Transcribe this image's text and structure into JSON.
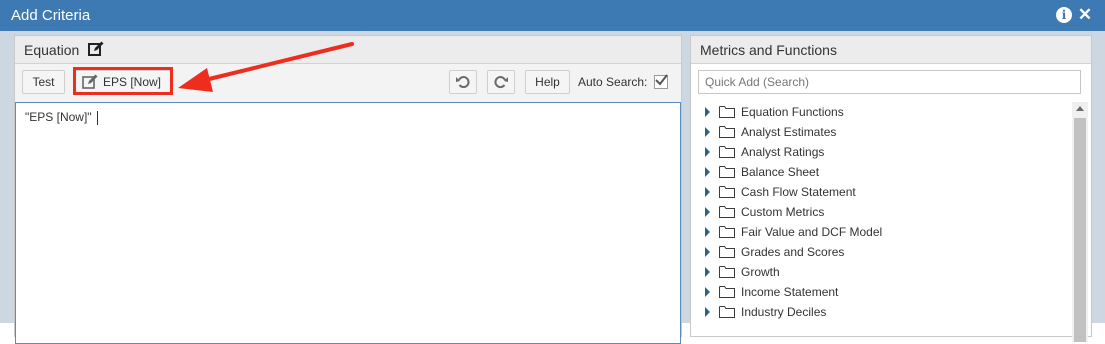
{
  "window": {
    "title": "Add Criteria",
    "info_icon": "info-icon",
    "close_icon": "close-icon"
  },
  "equation": {
    "title": "Equation",
    "title_icon": "edit-icon",
    "toolbar": {
      "test_label": "Test",
      "eps_label": "EPS [Now]",
      "eps_icon": "pencil-edit-icon",
      "undo_icon": "undo-icon",
      "redo_icon": "redo-icon",
      "help_label": "Help",
      "auto_search_label": "Auto Search:",
      "auto_search_checked": true
    },
    "editor_text": "\"EPS [Now]\""
  },
  "metrics": {
    "title": "Metrics and Functions",
    "search_placeholder": "Quick Add (Search)",
    "items": [
      {
        "label": "Equation Functions"
      },
      {
        "label": "Analyst Estimates"
      },
      {
        "label": "Analyst Ratings"
      },
      {
        "label": "Balance Sheet"
      },
      {
        "label": "Cash Flow Statement"
      },
      {
        "label": "Custom Metrics"
      },
      {
        "label": "Fair Value and DCF Model"
      },
      {
        "label": "Grades and Scores"
      },
      {
        "label": "Growth"
      },
      {
        "label": "Income Statement"
      },
      {
        "label": "Industry Deciles"
      }
    ]
  },
  "annotation": {
    "color": "#ee2d1f"
  },
  "colors": {
    "titlebar": "#3d7ab3",
    "accent": "#2e5f8f"
  }
}
